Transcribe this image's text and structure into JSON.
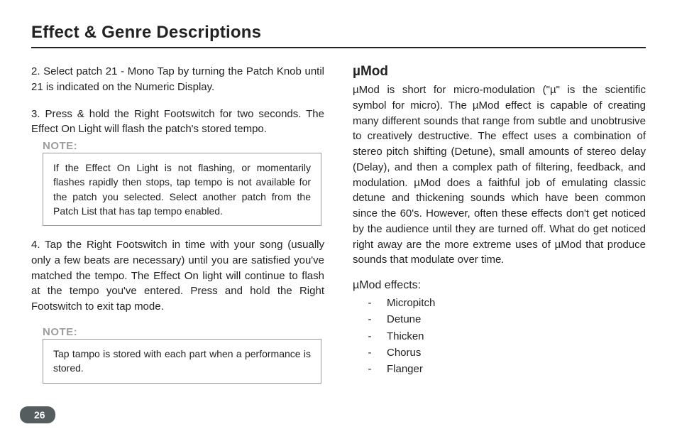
{
  "title": "Effect & Genre Descriptions",
  "left": {
    "p1": "2.  Select patch 21 - Mono Tap by turning the Patch Knob until 21 is indicated on the Numeric Display.",
    "p2": "3.  Press & hold the Right Footswitch for two seconds. The Effect On Light will flash the patch's stored tempo.",
    "note1_label": "NOTE:",
    "note1_body": "If the Effect On Light is not flashing, or momentarily flashes rapidly then stops, tap tempo is not available for the patch you selected. Select another patch from the Patch List that has tap tempo enabled.",
    "p3": "4.  Tap the Right Footswitch in time with your song (usually only a few beats are necessary) until you are satisfied you've matched the tempo.  The Effect On light will continue to flash at the tempo you've entered. Press and hold the Right Footswitch to exit tap mode.",
    "note2_label": "NOTE:",
    "note2_body": "Tap tampo is stored with each part when a performance is stored."
  },
  "right": {
    "heading": "µMod",
    "body": "µMod is short for micro-modulation (\"µ\" is the scientific symbol for micro). The µMod effect is capable of creating many different sounds that range from subtle and unobtrusive to creatively destructive. The effect uses a combination of stereo pitch shifting (Detune), small amounts of stereo delay (Delay), and then a complex path of filtering, feedback, and modulation. µMod does a faithful job of emulating classic detune and thickening sounds which have been common since the 60's. However, often these effects don't get noticed by the audience until they are turned off. What do get noticed right away are the more extreme uses of µMod that produce sounds that modulate over time.",
    "effects_heading": "µMod effects:",
    "effects": [
      "Micropitch",
      "Detune",
      "Thicken",
      "Chorus",
      "Flanger"
    ]
  },
  "page_number": "26"
}
